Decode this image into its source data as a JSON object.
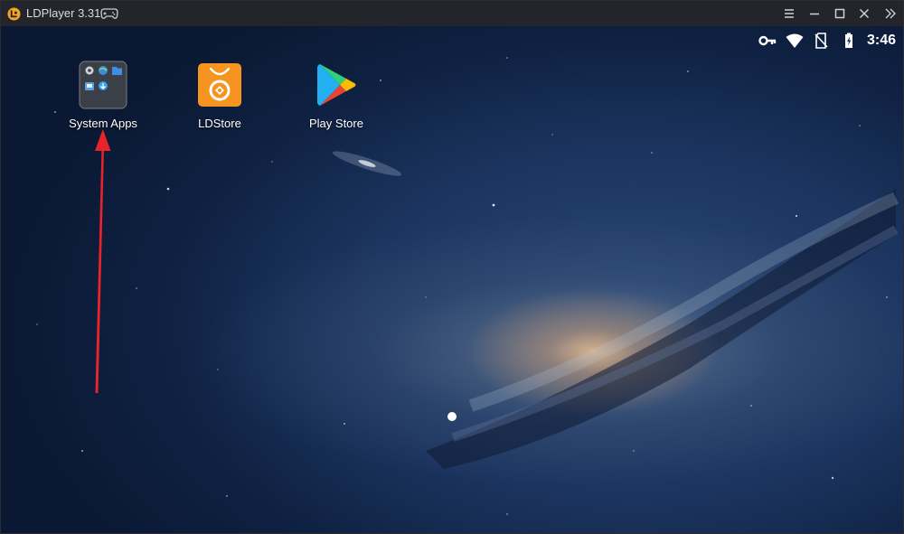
{
  "window": {
    "title": "LDPlayer 3.31",
    "accent_color": "#f5a623"
  },
  "titlebar": {
    "buttons": [
      {
        "name": "menu",
        "icon": "hamburger-menu-icon"
      },
      {
        "name": "minimize",
        "icon": "minimize-icon"
      },
      {
        "name": "maximize",
        "icon": "maximize-icon"
      },
      {
        "name": "close",
        "icon": "close-icon"
      },
      {
        "name": "expand-sidebar",
        "icon": "double-chevron-right-icon"
      }
    ]
  },
  "status_bar": {
    "icons": [
      "vpn-key-icon",
      "wifi-icon",
      "no-sim-icon",
      "battery-charging-icon"
    ],
    "time": "3:46"
  },
  "home": {
    "apps": [
      {
        "label": "System Apps",
        "icon": "system-apps-folder-icon"
      },
      {
        "label": "LDStore",
        "icon": "ldstore-icon",
        "color": "#f5941f"
      },
      {
        "label": "Play Store",
        "icon": "play-store-icon"
      }
    ],
    "annotation": {
      "type": "arrow",
      "color": "#e8242a",
      "points_to": "System Apps"
    },
    "page_indicator": {
      "current": 1,
      "total": 1
    }
  }
}
